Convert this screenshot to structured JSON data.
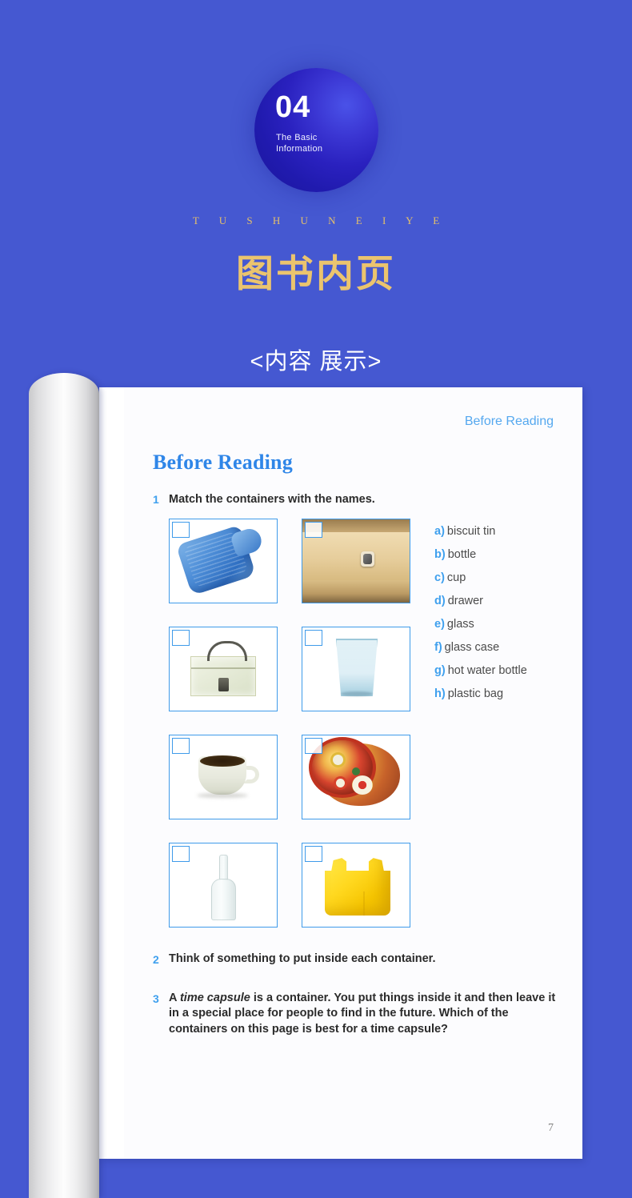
{
  "promo": {
    "badge": {
      "number": "04",
      "subtitle_line1": "The Basic",
      "subtitle_line2": "Information"
    },
    "latin_title": "T U S H U N E I Y E",
    "cn_title": "图书内页",
    "section_label": "<内容 展示>",
    "background_color": "#4558d1",
    "gold_color": "#ebc46e"
  },
  "book": {
    "running_head": "Before Reading",
    "page_title": "Before Reading",
    "page_number": "7",
    "accent_blue": "#3fa0ee",
    "exercises": [
      {
        "number": "1",
        "text": "Match the containers with the names."
      },
      {
        "number": "2",
        "text": "Think of something to put inside each container."
      },
      {
        "number": "3",
        "text_part1": "A ",
        "text_italic": "time capsule",
        "text_part2": " is a container. You put things inside it and then leave it in a special place for people to find in the future. Which of the containers on this page is best for a time capsule?"
      }
    ],
    "thumbnails": [
      {
        "id": "hot-water-bottle",
        "alt": "hot water bottle"
      },
      {
        "id": "drawer",
        "alt": "drawer"
      },
      {
        "id": "glass-case",
        "alt": "glass case"
      },
      {
        "id": "glass",
        "alt": "glass"
      },
      {
        "id": "cup",
        "alt": "cup"
      },
      {
        "id": "biscuit-tin",
        "alt": "biscuit tin"
      },
      {
        "id": "bottle",
        "alt": "bottle"
      },
      {
        "id": "plastic-bag",
        "alt": "plastic bag"
      }
    ],
    "word_list": [
      {
        "key": "a)",
        "label": "biscuit tin"
      },
      {
        "key": "b)",
        "label": "bottle"
      },
      {
        "key": "c)",
        "label": "cup"
      },
      {
        "key": "d)",
        "label": "drawer"
      },
      {
        "key": "e)",
        "label": "glass"
      },
      {
        "key": "f)",
        "label": "glass case"
      },
      {
        "key": "g)",
        "label": "hot water bottle"
      },
      {
        "key": "h)",
        "label": "plastic bag"
      }
    ]
  }
}
